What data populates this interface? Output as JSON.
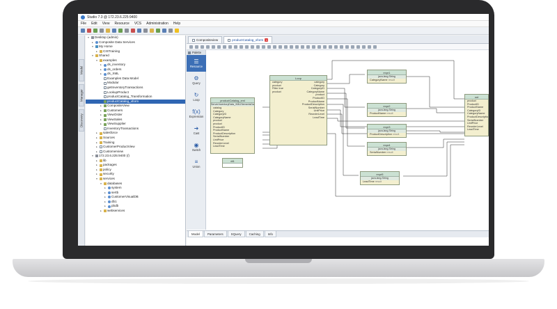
{
  "window": {
    "title": "Studio 7.3 @ 172.23.6.225:9400"
  },
  "menu": [
    "File",
    "Edit",
    "View",
    "Resource",
    "VCS",
    "Administration",
    "Help"
  ],
  "rail_tabs": [
    "Model",
    "Manager",
    "Discovery"
  ],
  "tree": [
    {
      "depth": 0,
      "twisty": "▾",
      "icon": "server",
      "label": "Desktop (admin)"
    },
    {
      "depth": 1,
      "twisty": "▸",
      "icon": "db",
      "label": "Composite Data Services"
    },
    {
      "depth": 1,
      "twisty": "▾",
      "icon": "home",
      "label": "My Home"
    },
    {
      "depth": 2,
      "twisty": "▸",
      "icon": "folder",
      "label": "CISTraining"
    },
    {
      "depth": 1,
      "twisty": "▾",
      "icon": "folder",
      "label": "Shared"
    },
    {
      "depth": 2,
      "twisty": "▾",
      "icon": "folder",
      "label": "examples"
    },
    {
      "depth": 3,
      "twisty": "▸",
      "icon": "db",
      "label": "ds_inventory"
    },
    {
      "depth": 3,
      "twisty": "▸",
      "icon": "db",
      "label": "ds_orders"
    },
    {
      "depth": 3,
      "twisty": "▸",
      "icon": "db",
      "label": "ds_XML"
    },
    {
      "depth": 3,
      "twisty": "",
      "icon": "doc",
      "label": "Examples Data Model"
    },
    {
      "depth": 3,
      "twisty": "",
      "icon": "doc",
      "label": "Modular"
    },
    {
      "depth": 3,
      "twisty": "",
      "icon": "doc",
      "label": "getInventoryTransactions"
    },
    {
      "depth": 3,
      "twisty": "",
      "icon": "doc",
      "label": "LookupProduct"
    },
    {
      "depth": 3,
      "twisty": "",
      "icon": "doc",
      "label": "productCatalog_Transformation"
    },
    {
      "depth": 3,
      "twisty": "",
      "icon": "view",
      "label": "productCatalog_xform",
      "selected": true
    },
    {
      "depth": 3,
      "twisty": "▸",
      "icon": "view",
      "label": "CompositeView"
    },
    {
      "depth": 3,
      "twisty": "▸",
      "icon": "view",
      "label": "Customers"
    },
    {
      "depth": 3,
      "twisty": "▸",
      "icon": "view",
      "label": "ViewOrder"
    },
    {
      "depth": 3,
      "twisty": "▸",
      "icon": "view",
      "label": "ViewSales"
    },
    {
      "depth": 3,
      "twisty": "▸",
      "icon": "view",
      "label": "ViewSupplier"
    },
    {
      "depth": 3,
      "twisty": "",
      "icon": "doc",
      "label": "InventoryTransactions"
    },
    {
      "depth": 2,
      "twisty": "▸",
      "icon": "folder",
      "label": "salesforce"
    },
    {
      "depth": 2,
      "twisty": "▸",
      "icon": "folder",
      "label": "Sources"
    },
    {
      "depth": 2,
      "twisty": "▸",
      "icon": "folder",
      "label": "Training"
    },
    {
      "depth": 2,
      "twisty": "▸",
      "icon": "doc",
      "label": "CustomerProductView"
    },
    {
      "depth": 2,
      "twisty": "▸",
      "icon": "doc",
      "label": "Customerview"
    },
    {
      "depth": 1,
      "twisty": "▾",
      "icon": "server",
      "label": "172.23.6.225:9400 (/)"
    },
    {
      "depth": 2,
      "twisty": "▸",
      "icon": "folder",
      "label": "lib"
    },
    {
      "depth": 2,
      "twisty": "▸",
      "icon": "folder",
      "label": "packages"
    },
    {
      "depth": 2,
      "twisty": "▸",
      "icon": "folder",
      "label": "policy"
    },
    {
      "depth": 2,
      "twisty": "▸",
      "icon": "folder",
      "label": "security"
    },
    {
      "depth": 2,
      "twisty": "▾",
      "icon": "folder",
      "label": "services"
    },
    {
      "depth": 3,
      "twisty": "▾",
      "icon": "folder",
      "label": "databases"
    },
    {
      "depth": 4,
      "twisty": "▸",
      "icon": "db",
      "label": "system"
    },
    {
      "depth": 4,
      "twisty": "▸",
      "icon": "db",
      "label": "sertb"
    },
    {
      "depth": 4,
      "twisty": "▸",
      "icon": "db",
      "label": "CustomerVisualDB"
    },
    {
      "depth": 4,
      "twisty": "▸",
      "icon": "db",
      "label": "db1"
    },
    {
      "depth": 4,
      "twisty": "▸",
      "icon": "db",
      "label": "pbdb"
    },
    {
      "depth": 3,
      "twisty": "▸",
      "icon": "folder",
      "label": "webservices"
    }
  ],
  "editor": {
    "tabs": [
      {
        "label": "Compositeview",
        "active": false
      },
      {
        "label": "productCatalog_xform",
        "active": true
      }
    ],
    "palette_head": "Palette",
    "palette": [
      {
        "glyph": "☰",
        "label": "Resource"
      },
      {
        "glyph": "⚙",
        "label": "Query"
      },
      {
        "glyph": "↻",
        "label": "Loop"
      },
      {
        "glyph": "f(x)",
        "label": "Expression"
      },
      {
        "glyph": "➜",
        "label": "Cast"
      },
      {
        "glyph": "◉",
        "label": "Switch"
      },
      {
        "glyph": "≡",
        "label": "Union"
      }
    ],
    "bottom_tabs": [
      "Model",
      "Parameters",
      "SQuery",
      "Caching",
      "Info"
    ]
  },
  "nodes": {
    "source": {
      "title": "productCatalog_xml",
      "sub": "ServerInventoryData_XMLElementsData",
      "rows": [
        "catalog",
        "Category",
        "CategoryID",
        "CategoryName",
        "product",
        "product",
        "ProductID",
        "ProductName",
        "ProductDescription",
        "SerialNumber",
        "UnitPrice",
        "ReorderLevel",
        "LeadTime"
      ]
    },
    "small": {
      "title": "dt1"
    },
    "loop": {
      "title": "Loop",
      "left": [
        "category",
        "product",
        "Filter true",
        "product"
      ],
      "right": [
        "category",
        "Category",
        "CategoryID",
        "CategoryName",
        "product",
        "ProductID",
        "ProductName",
        "ProductDescription",
        "SerialNumber",
        "UnitPrice",
        "ReorderLevel",
        "LeadTime"
      ],
      "footer": "Filter true"
    },
    "target": {
      "title": "out",
      "rows": [
        "product",
        "ProductID",
        "ProductName",
        "CategoryID",
        "CategoryName",
        "ProductDescription",
        "SerialNumber",
        "UnitPrice",
        "ReorderLevel",
        "LeadTime"
      ]
    },
    "exprs": [
      {
        "title": "expr1",
        "sub": "java.lang.String",
        "row": "CategoryName",
        "result": "result"
      },
      {
        "title": "expr2",
        "sub": "java.lang.String",
        "row": "ProductName",
        "result": "result"
      },
      {
        "title": "expr3",
        "sub": "java.lang.String",
        "row": "ProductDescription",
        "result": "result"
      },
      {
        "title": "expr4",
        "sub": "java.lang.String",
        "row": "SerialNumber",
        "result": "result"
      },
      {
        "title": "expr5",
        "sub": "java.lang.String",
        "row": "LeadTime",
        "result": "result"
      }
    ]
  },
  "colors": {
    "selection": "#2f66b3",
    "node_header": "#cbe1d3",
    "node_body": "#f3efcf",
    "connector": "#2a2a2a"
  }
}
